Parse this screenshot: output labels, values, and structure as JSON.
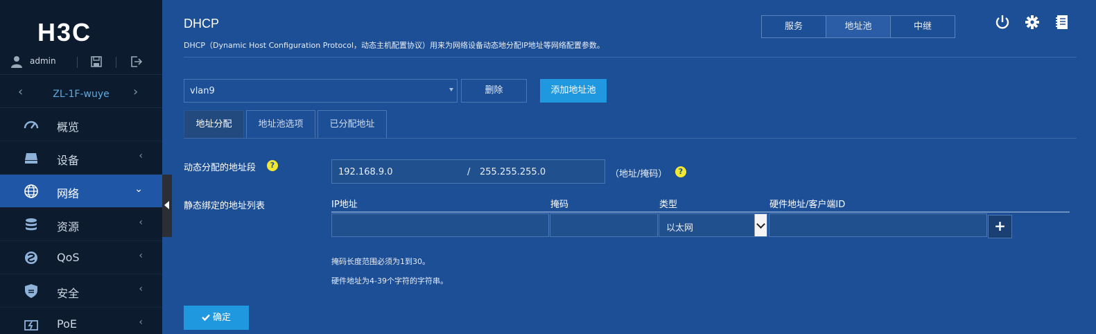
{
  "brand": {
    "logo": "H3C"
  },
  "user": {
    "name": "admin"
  },
  "device": {
    "name": "ZL-1F-wuye"
  },
  "sidebar": {
    "items": [
      {
        "label": "概览",
        "icon": "dashboard-icon"
      },
      {
        "label": "设备",
        "icon": "device-icon",
        "chevron": "‹"
      },
      {
        "label": "网络",
        "icon": "globe-icon",
        "chevron": "⌄"
      },
      {
        "label": "资源",
        "icon": "database-icon",
        "chevron": "‹"
      },
      {
        "label": "QoS",
        "icon": "qos-icon",
        "chevron": "‹"
      },
      {
        "label": "安全",
        "icon": "shield-icon",
        "chevron": "‹"
      },
      {
        "label": "PoE",
        "icon": "poe-icon",
        "chevron": "‹"
      }
    ]
  },
  "page": {
    "title": "DHCP",
    "description": "DHCP（Dynamic Host Configuration Protocol，动态主机配置协议）用来为网络设备动态地分配IP地址等网络配置参数。"
  },
  "top_tabs": [
    "服务",
    "地址池",
    "中继"
  ],
  "pool": {
    "selected": "vlan9",
    "delete_label": "删除",
    "add_label": "添加地址池"
  },
  "sub_tabs": [
    "地址分配",
    "地址池选项",
    "已分配地址"
  ],
  "form": {
    "dynamic_label": "动态分配的地址段",
    "ip": "192.168.9.0",
    "slash": "/",
    "mask": "255.255.255.0",
    "range_note": "（地址/掩码）",
    "help_glyph": "?",
    "static_label": "静态绑定的地址列表",
    "columns": [
      "IP地址",
      "掩码",
      "类型",
      "硬件地址/客户端ID"
    ],
    "type_value": "以太网",
    "add_glyph": "+",
    "hint1": "掩码长度范围必须为1到30。",
    "hint2": "硬件地址为4-39个字符的字符串。",
    "confirm_label": "确定"
  },
  "colors": {
    "background": "#1d4f96",
    "sidebar": "#0c1c2e",
    "accent": "#1f98e0",
    "help": "#f2e832"
  }
}
